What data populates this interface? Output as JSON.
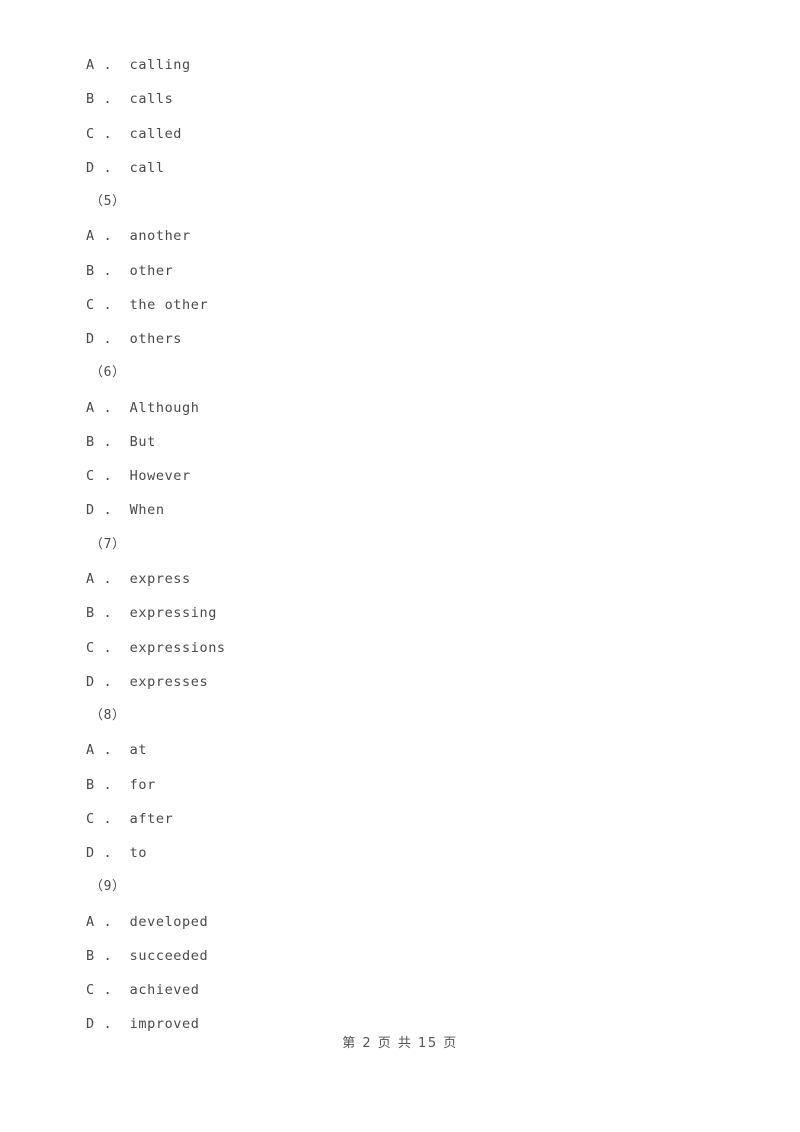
{
  "document": {
    "background_color": "#ffffff",
    "text_color": "#4a4a4a"
  },
  "blocks": [
    {
      "question_number": null,
      "options": [
        {
          "letter": "A",
          "separator": " .  ",
          "text": "calling"
        },
        {
          "letter": "B",
          "separator": " .  ",
          "text": "calls"
        },
        {
          "letter": "C",
          "separator": " .  ",
          "text": "called"
        },
        {
          "letter": "D",
          "separator": " .  ",
          "text": "call"
        }
      ]
    },
    {
      "question_number": "（5）",
      "options": [
        {
          "letter": "A",
          "separator": " .  ",
          "text": "another"
        },
        {
          "letter": "B",
          "separator": " .  ",
          "text": "other"
        },
        {
          "letter": "C",
          "separator": " .  ",
          "text": "the other"
        },
        {
          "letter": "D",
          "separator": " .  ",
          "text": "others"
        }
      ]
    },
    {
      "question_number": "（6）",
      "options": [
        {
          "letter": "A",
          "separator": " .  ",
          "text": "Although"
        },
        {
          "letter": "B",
          "separator": " .  ",
          "text": "But"
        },
        {
          "letter": "C",
          "separator": " .  ",
          "text": "However"
        },
        {
          "letter": "D",
          "separator": " .  ",
          "text": "When"
        }
      ]
    },
    {
      "question_number": "（7）",
      "options": [
        {
          "letter": "A",
          "separator": " .  ",
          "text": "express"
        },
        {
          "letter": "B",
          "separator": " .  ",
          "text": "expressing"
        },
        {
          "letter": "C",
          "separator": " .  ",
          "text": "expressions"
        },
        {
          "letter": "D",
          "separator": " .  ",
          "text": "expresses"
        }
      ]
    },
    {
      "question_number": "（8）",
      "options": [
        {
          "letter": "A",
          "separator": " .  ",
          "text": "at"
        },
        {
          "letter": "B",
          "separator": " .  ",
          "text": "for"
        },
        {
          "letter": "C",
          "separator": " .  ",
          "text": "after"
        },
        {
          "letter": "D",
          "separator": " .  ",
          "text": "to"
        }
      ]
    },
    {
      "question_number": "（9）",
      "options": [
        {
          "letter": "A",
          "separator": " .  ",
          "text": "developed"
        },
        {
          "letter": "B",
          "separator": " .  ",
          "text": "succeeded"
        },
        {
          "letter": "C",
          "separator": " .  ",
          "text": "achieved"
        },
        {
          "letter": "D",
          "separator": " .  ",
          "text": "improved"
        }
      ]
    }
  ],
  "footer": {
    "text": "第 2 页 共 15 页",
    "current_page": "2",
    "total_pages": "15"
  }
}
